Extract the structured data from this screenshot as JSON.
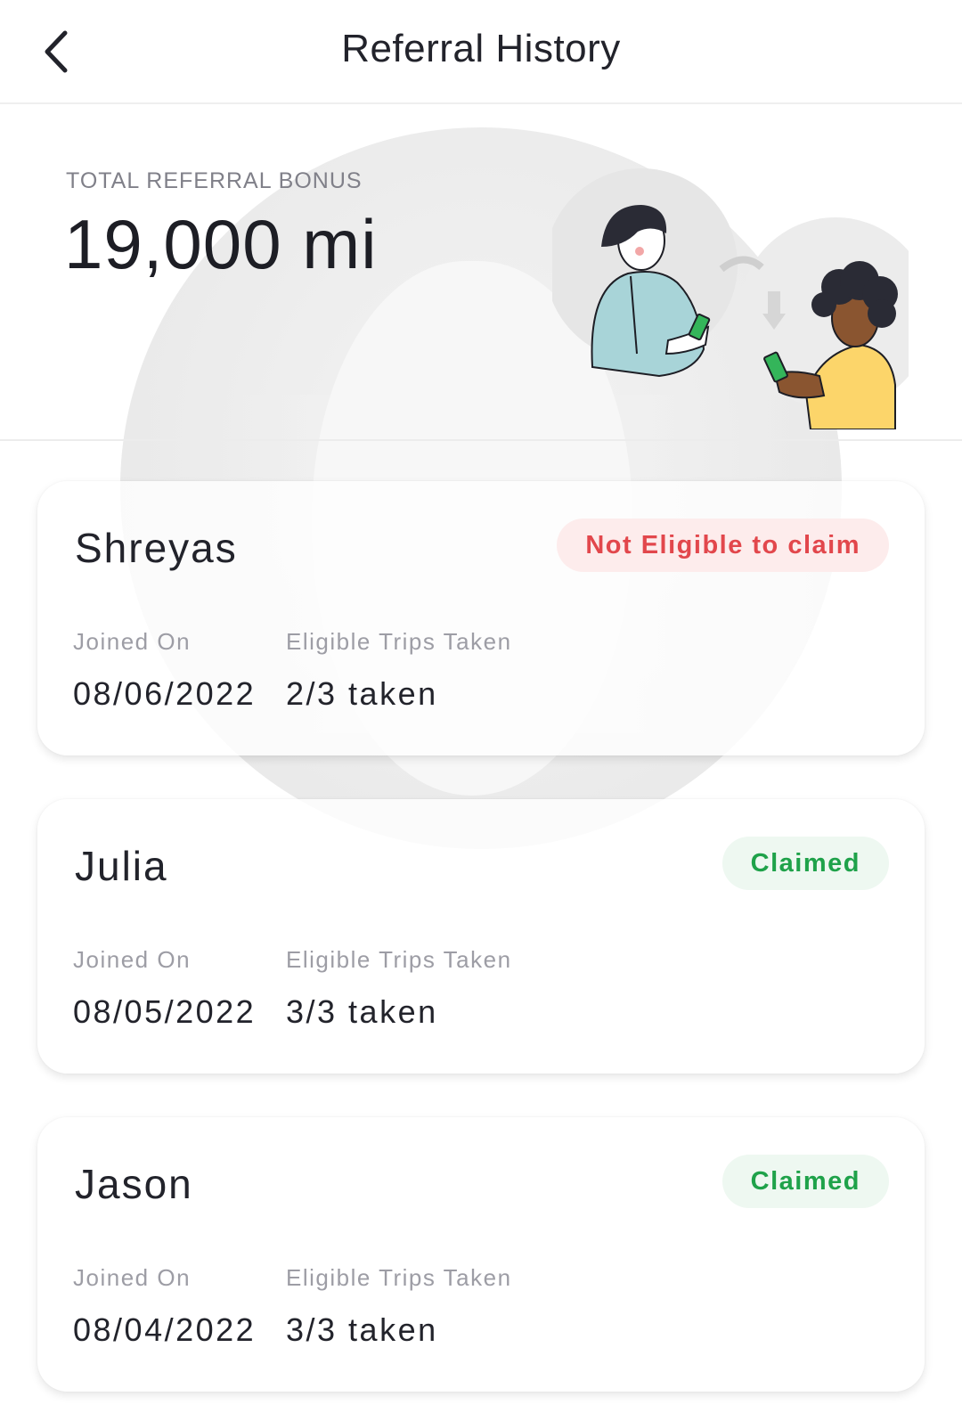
{
  "header": {
    "title": "Referral History",
    "back_icon": "chevron-left-icon"
  },
  "summary": {
    "label": "TOTAL REFERRAL BONUS",
    "value": "19,000 mi",
    "illustration": "referral-people-illustration"
  },
  "columns": {
    "joined_label": "Joined On",
    "trips_label": "Eligible Trips Taken"
  },
  "referrals": [
    {
      "name": "Shreyas",
      "status": "Not Eligible to claim",
      "status_color": "#e2474c",
      "joined": "08/06/2022",
      "trips": "2/3 taken"
    },
    {
      "name": "Julia",
      "status": "Claimed",
      "status_color": "#1fa24a",
      "joined": "08/05/2022",
      "trips": "3/3 taken"
    },
    {
      "name": "Jason",
      "status": "Claimed",
      "status_color": "#1fa24a",
      "joined": "08/04/2022",
      "trips": "3/3 taken"
    }
  ]
}
